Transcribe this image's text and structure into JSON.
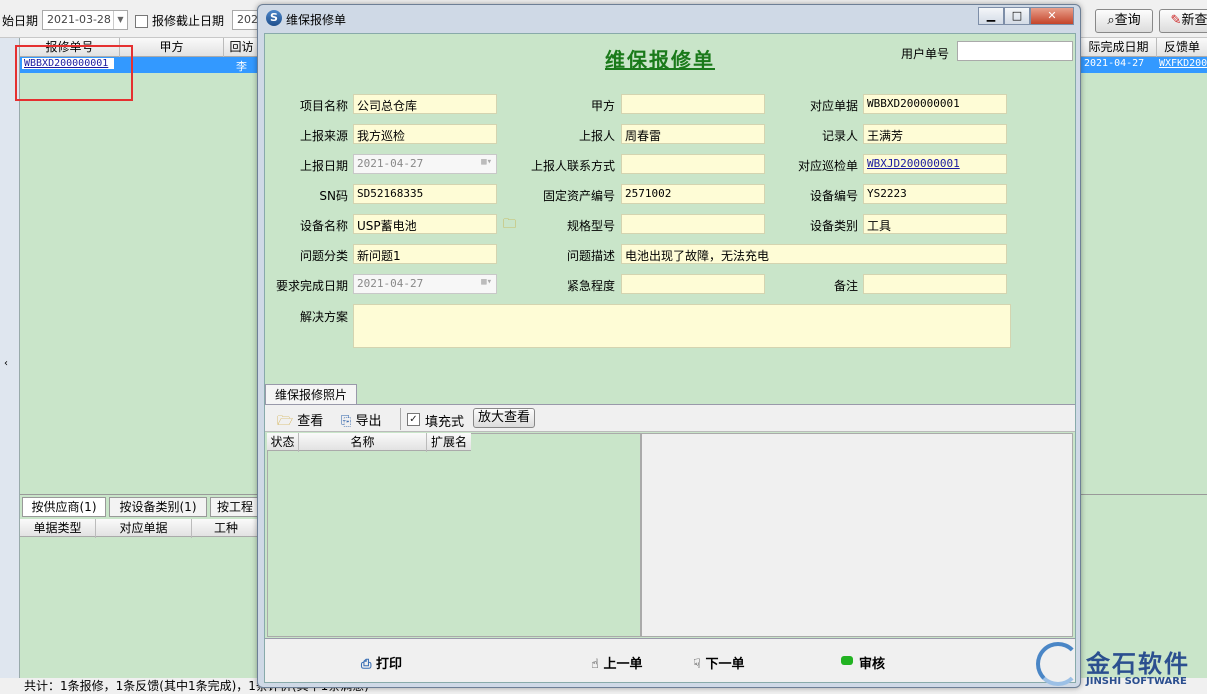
{
  "top": {
    "start_date_label": "始日期",
    "start_date_value": "2021-03-28",
    "end_date_check_label": "报修截止日期",
    "end_date_partial": "2021",
    "query_button": "查询",
    "new_button": "新查"
  },
  "grid": {
    "headers": [
      "报修单号",
      "甲方",
      "回访",
      "际完成日期",
      "反馈单"
    ],
    "row": {
      "code": "WBBXD200000001",
      "party_partial": "李",
      "finish_date": "2021-04-27",
      "feedback": "WXFKD200"
    }
  },
  "lower": {
    "tabs": [
      "按供应商(1)",
      "按设备类别(1)",
      "按工程"
    ],
    "headers": [
      "单据类型",
      "对应单据",
      "工种"
    ]
  },
  "status": "共计：1条报修，1条反馈(其中1条完成)，1条评价(其中1条满意)",
  "dialog": {
    "title": "维保报修单",
    "form_title": "维保报修单",
    "user_no_label": "用户单号",
    "user_no_value": "",
    "fields": {
      "project_name": {
        "label": "项目名称",
        "value": "公司总仓库"
      },
      "party_a": {
        "label": "甲方",
        "value": ""
      },
      "linked_doc": {
        "label": "对应单据",
        "value": "WBBXD200000001"
      },
      "source": {
        "label": "上报来源",
        "value": "我方巡检"
      },
      "reporter": {
        "label": "上报人",
        "value": "周春雷"
      },
      "recorder": {
        "label": "记录人",
        "value": "王满芳"
      },
      "report_date": {
        "label": "上报日期",
        "value": "2021-04-27"
      },
      "reporter_contact": {
        "label": "上报人联系方式",
        "value": ""
      },
      "linked_patrol": {
        "label": "对应巡检单",
        "value": "WBXJD200000001"
      },
      "sn": {
        "label": "SN码",
        "value": "SD52168335"
      },
      "asset_no": {
        "label": "固定资产编号",
        "value": "2571002"
      },
      "device_no": {
        "label": "设备编号",
        "value": "YS2223"
      },
      "device_name": {
        "label": "设备名称",
        "value": "USP蓄电池"
      },
      "spec": {
        "label": "规格型号",
        "value": ""
      },
      "device_type": {
        "label": "设备类别",
        "value": "工具"
      },
      "issue_type": {
        "label": "问题分类",
        "value": "新问题1"
      },
      "issue_desc": {
        "label": "问题描述",
        "value": "电池出现了故障，无法充电"
      },
      "due_date": {
        "label": "要求完成日期",
        "value": "2021-04-27"
      },
      "urgency": {
        "label": "紧急程度",
        "value": ""
      },
      "remark": {
        "label": "备注",
        "value": ""
      },
      "solution": {
        "label": "解决方案",
        "value": ""
      }
    },
    "photo_tab": "维保报修照片",
    "photo_toolbar": {
      "view": "查看",
      "export": "导出",
      "fill": "填充式",
      "zoom": "放大查看"
    },
    "photo_headers": [
      "状态",
      "名称",
      "扩展名"
    ],
    "bottom": {
      "print": "打印",
      "prev": "上一单",
      "next": "下一单",
      "audit": "审核"
    }
  },
  "logo": {
    "cn": "金石软件",
    "en": "JINSHI SOFTWARE"
  },
  "colors": {
    "form_green": "#c9e5c9",
    "field_yellow": "#fefcd6",
    "title_green": "#1a7a1a",
    "select_blue": "#3399ff",
    "highlight_red": "#e53030"
  }
}
